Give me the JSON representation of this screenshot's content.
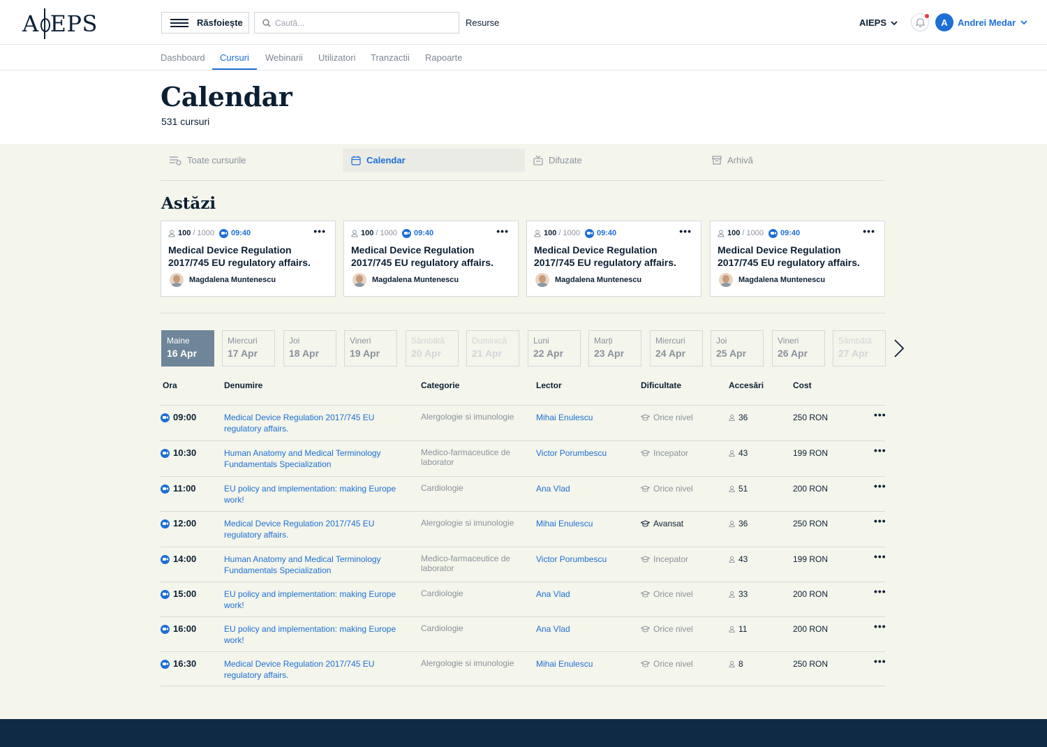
{
  "header": {
    "logo_text": "AIEPS",
    "browse_label": "Răsfoiește",
    "search_placeholder": "Caută...",
    "resources_label": "Resurse",
    "org_label": "AIEPS",
    "user_initial": "A",
    "user_name": "Andrei Medar"
  },
  "subnav": {
    "tabs": [
      "Dashboard",
      "Cursuri",
      "Webinarii",
      "Utilizatori",
      "Tranzactii",
      "Rapoarte"
    ],
    "active": "Cursuri"
  },
  "page": {
    "title": "Calendar",
    "count": "531 cursuri"
  },
  "view_tabs": {
    "items": [
      "Toate cursurile",
      "Calendar",
      "Difuzate",
      "Arhivă"
    ],
    "active": "Calendar"
  },
  "today": {
    "title": "Astăzi",
    "cards": [
      {
        "enrolled": "100",
        "capacity": "/ 1000",
        "time": "09:40",
        "title": "Medical Device Regulation 2017/745 EU regulatory affairs.",
        "lecturer": "Magdalena Muntenescu"
      },
      {
        "enrolled": "100",
        "capacity": "/ 1000",
        "time": "09:40",
        "title": "Medical Device Regulation 2017/745 EU regulatory affairs.",
        "lecturer": "Magdalena Muntenescu"
      },
      {
        "enrolled": "100",
        "capacity": "/ 1000",
        "time": "09:40",
        "title": "Medical Device Regulation 2017/745 EU regulatory affairs.",
        "lecturer": "Magdalena Muntenescu"
      },
      {
        "enrolled": "100",
        "capacity": "/ 1000",
        "time": "09:40",
        "title": "Medical Device Regulation 2017/745 EU regulatory affairs.",
        "lecturer": "Magdalena Muntenescu"
      }
    ]
  },
  "days": [
    {
      "name": "Maine",
      "date": "16 Apr",
      "state": "active"
    },
    {
      "name": "Miercuri",
      "date": "17 Apr",
      "state": "normal"
    },
    {
      "name": "Joi",
      "date": "18 Apr",
      "state": "normal"
    },
    {
      "name": "Vineri",
      "date": "19 Apr",
      "state": "normal"
    },
    {
      "name": "Sâmbătă",
      "date": "20 Apr",
      "state": "disabled"
    },
    {
      "name": "Duminică",
      "date": "21 Apr",
      "state": "disabled"
    },
    {
      "name": "Luni",
      "date": "22 Apr",
      "state": "normal"
    },
    {
      "name": "Marți",
      "date": "23 Apr",
      "state": "normal"
    },
    {
      "name": "Miercuri",
      "date": "24 Apr",
      "state": "normal"
    },
    {
      "name": "Joi",
      "date": "25 Apr",
      "state": "normal"
    },
    {
      "name": "Vineri",
      "date": "26 Apr",
      "state": "normal"
    },
    {
      "name": "Sâmbătă",
      "date": "27 Apr",
      "state": "disabled"
    }
  ],
  "table": {
    "headers": {
      "time": "Ora",
      "name": "Denumire",
      "category": "Categorie",
      "lecturer": "Lector",
      "difficulty": "Dificultate",
      "access": "Accesări",
      "cost": "Cost"
    },
    "rows": [
      {
        "time": "09:00",
        "name": "Medical Device Regulation 2017/745 EU regulatory affairs.",
        "category": "Alergologie si imunologie",
        "lecturer": "Mihai Enulescu",
        "difficulty": "Orice nivel",
        "access": "36",
        "cost": "250 RON"
      },
      {
        "time": "10:30",
        "name": "Human Anatomy and Medical Terminology Fundamentals Specialization",
        "category": "Medico-farmaceutice de laborator",
        "lecturer": "Victor Porumbescu",
        "difficulty": "Incepator",
        "access": "43",
        "cost": "199 RON"
      },
      {
        "time": "11:00",
        "name": "EU policy and implementation: making Europe work!",
        "category": "Cardiologie",
        "lecturer": "Ana Vlad",
        "difficulty": "Orice nivel",
        "access": "51",
        "cost": "200 RON"
      },
      {
        "time": "12:00",
        "name": "Medical Device Regulation 2017/745 EU regulatory affairs.",
        "category": "Alergologie si imunologie",
        "lecturer": "Mihai Enulescu",
        "difficulty": "Avansat",
        "access": "36",
        "cost": "250 RON"
      },
      {
        "time": "14:00",
        "name": "Human Anatomy and Medical Terminology Fundamentals Specialization",
        "category": "Medico-farmaceutice de laborator",
        "lecturer": "Victor Porumbescu",
        "difficulty": "Incepator",
        "access": "43",
        "cost": "199 RON"
      },
      {
        "time": "15:00",
        "name": "EU policy and implementation: making Europe work!",
        "category": "Cardiologie",
        "lecturer": "Ana Vlad",
        "difficulty": "Orice nivel",
        "access": "33",
        "cost": "200 RON"
      },
      {
        "time": "16:00",
        "name": "EU policy and implementation: making Europe work!",
        "category": "Cardiologie",
        "lecturer": "Ana Vlad",
        "difficulty": "Orice nivel",
        "access": "11",
        "cost": "200 RON"
      },
      {
        "time": "16:30",
        "name": "Medical Device Regulation 2017/745 EU regulatory affairs.",
        "category": "Alergologie si imunologie",
        "lecturer": "Mihai Enulescu",
        "difficulty": "Orice nivel",
        "access": "8",
        "cost": "250 RON"
      }
    ]
  },
  "colors": {
    "accent": "#1c6fd6",
    "navy": "#0b1f33",
    "section_bg": "#f4f5eb",
    "active_day": "#6f8599",
    "footer": "#0f2a44",
    "notification_dot": "#e23a4a"
  },
  "icons": [
    "menu-icon",
    "search-icon",
    "chevron-down-icon",
    "bell-icon",
    "list-icon",
    "calendar-icon",
    "broadcast-icon",
    "archive-icon",
    "user-icon",
    "video-icon",
    "more-icon",
    "graduation-cap-icon",
    "chevron-right-icon"
  ]
}
